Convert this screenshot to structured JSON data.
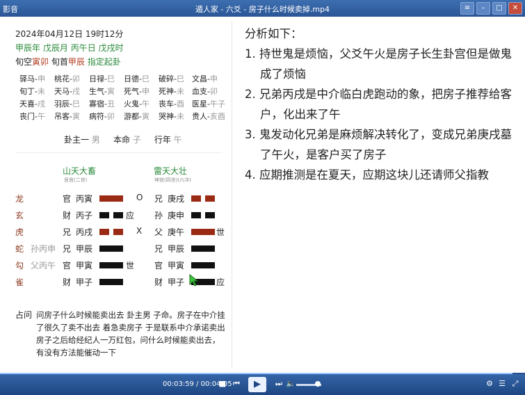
{
  "window": {
    "app": "影音",
    "title": "遁人家 - 六爻 - 房子什么时候卖掉.mp4"
  },
  "chart": {
    "datetime": "2024年04月12日 19时12分",
    "ganzhi": [
      "甲辰年",
      "戊辰月",
      "丙午日",
      "戊戌时"
    ],
    "kongwang_label": "旬空",
    "kongwang_value": "寅卯",
    "xunshou_label": "旬首",
    "xunshou_value": "甲辰",
    "method": "指定起卦",
    "shensha": [
      [
        {
          "k": "驿马-",
          "v": "申"
        },
        {
          "k": "桃花-",
          "v": "卯"
        },
        {
          "k": "日禄-",
          "v": "巳"
        },
        {
          "k": "日德-",
          "v": "巳"
        },
        {
          "k": "破碎-",
          "v": "巳"
        },
        {
          "k": "文昌-",
          "v": "申"
        }
      ],
      [
        {
          "k": "旬丁-",
          "v": "未"
        },
        {
          "k": "天马-",
          "v": "戌"
        },
        {
          "k": "生气-",
          "v": "寅"
        },
        {
          "k": "死气-",
          "v": "申"
        },
        {
          "k": "死神-",
          "v": "未"
        },
        {
          "k": "血支-",
          "v": "卯"
        }
      ],
      [
        {
          "k": "天喜-",
          "v": "戌"
        },
        {
          "k": "羽辰-",
          "v": "巳"
        },
        {
          "k": "寡宿-",
          "v": "丑"
        },
        {
          "k": "火鬼-",
          "v": "午"
        },
        {
          "k": "丧车-",
          "v": "酉"
        },
        {
          "k": "医星-",
          "v": "午子"
        }
      ],
      [
        {
          "k": "丧门-",
          "v": "午"
        },
        {
          "k": "吊客-",
          "v": "寅"
        },
        {
          "k": "病符-",
          "v": "卯"
        },
        {
          "k": "游都-",
          "v": "寅"
        },
        {
          "k": "哭神-",
          "v": "未"
        },
        {
          "k": "贵人-",
          "v": "亥酉"
        }
      ]
    ],
    "guazhu_label": "卦主一",
    "guazhu_value": "男",
    "benming_label": "本命",
    "benming_value": "子",
    "xingnian_label": "行年",
    "xingnian_value": "午",
    "main_hex": {
      "name": "山天大畜",
      "palace": "艮宫(二世)"
    },
    "changed_hex": {
      "name": "雷天大壮",
      "palace": "坤宫(四世)(六冲)"
    },
    "lines": [
      {
        "god": "龙",
        "fushen": "",
        "rel": "官",
        "gz": "丙寅",
        "mark": "O",
        "shiying": "",
        "crel": "兄",
        "cgz": "庚戌",
        "cshiying": ""
      },
      {
        "god": "玄",
        "fushen": "",
        "rel": "财",
        "gz": "丙子",
        "mark": "",
        "shiying": "应",
        "crel": "孙",
        "cgz": "庚申",
        "cshiying": ""
      },
      {
        "god": "虎",
        "fushen": "",
        "rel": "兄",
        "gz": "丙戌",
        "mark": "X",
        "shiying": "",
        "crel": "父",
        "cgz": "庚午",
        "cshiying": "世"
      },
      {
        "god": "蛇",
        "fushen": "孙丙申",
        "rel": "兄",
        "gz": "甲辰",
        "mark": "",
        "shiying": "",
        "crel": "兄",
        "cgz": "甲辰",
        "cshiying": ""
      },
      {
        "god": "勾",
        "fushen": "父丙午",
        "rel": "官",
        "gz": "甲寅",
        "mark": "",
        "shiying": "世",
        "crel": "官",
        "cgz": "甲寅",
        "cshiying": ""
      },
      {
        "god": "雀",
        "fushen": "",
        "rel": "财",
        "gz": "甲子",
        "mark": "",
        "shiying": "",
        "crel": "财",
        "cgz": "甲子",
        "cshiying": "应"
      }
    ],
    "question_label": "占问",
    "question": "问房子什么时候能卖出去 卦主男 子命。房子在中介挂了很久了卖不出去 着急卖房子 于是联系中介承诺卖出房子之后给经纪人一万红包，问什么时候能卖出去，有没有方法能催动一下"
  },
  "analysis": {
    "title": "分析如下：",
    "items": [
      "1. 持世鬼是烦恼，父爻午火是房子长生卦宫但是做鬼成了烦恼",
      "2. 兄弟丙戌是中介临白虎跑动的象，把房子推荐给客户，化出来了午",
      "3. 鬼发动化兄弟是麻烦解决转化了，变成兄弟庚戌墓了午火，是客户买了房子",
      "4. 应期推测是在夏天，应期这块儿还请师父指教"
    ]
  },
  "player": {
    "time": "00:03:59 / 00:04:05",
    "progress": 0.976
  }
}
